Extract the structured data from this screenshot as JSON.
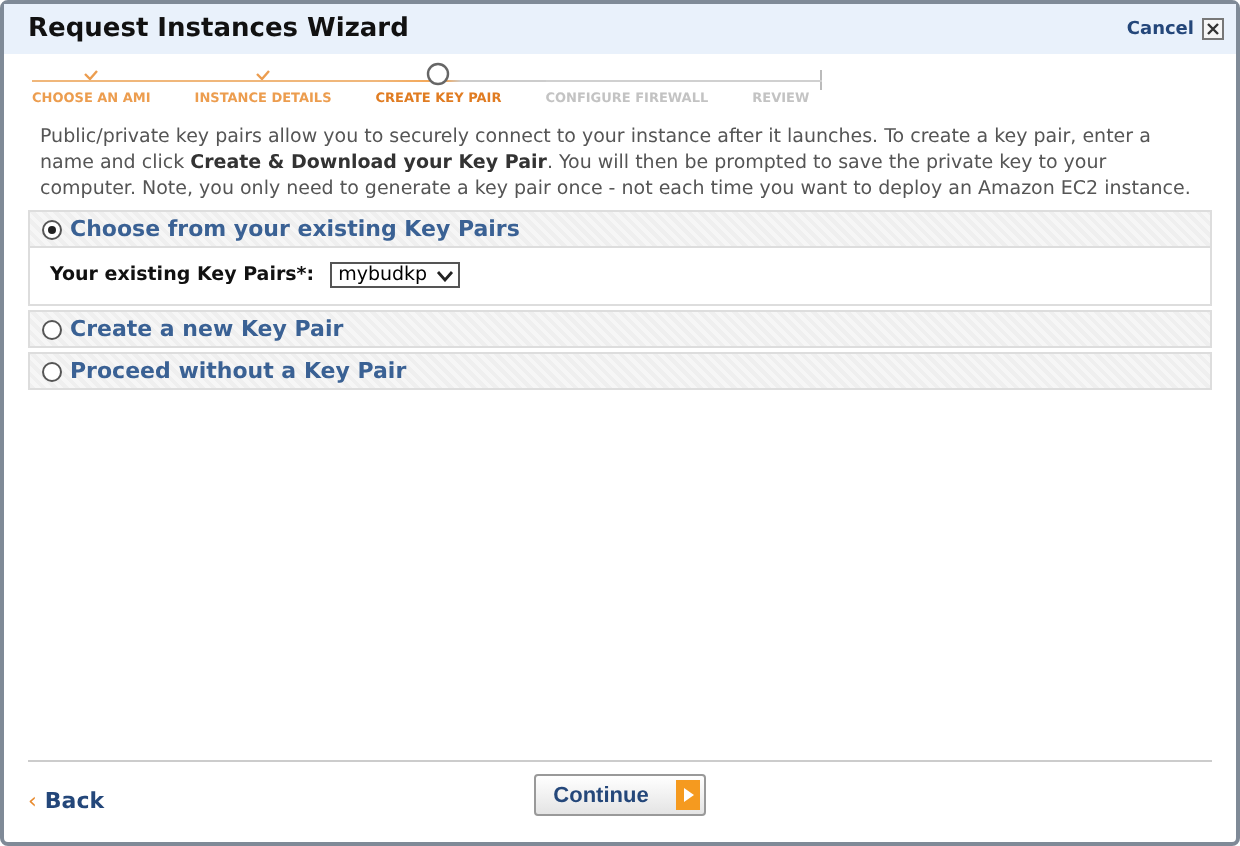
{
  "window": {
    "title": "Request Instances Wizard",
    "cancel": "Cancel"
  },
  "steps": [
    {
      "label": "CHOOSE AN AMI",
      "completed": true,
      "selected": false
    },
    {
      "label": "INSTANCE DETAILS",
      "completed": true,
      "selected": false
    },
    {
      "label": "CREATE KEY PAIR",
      "completed": false,
      "selected": true
    },
    {
      "label": "CONFIGURE FIREWALL",
      "completed": false,
      "selected": false
    },
    {
      "label": "REVIEW",
      "completed": false,
      "selected": false
    }
  ],
  "description": "Public/private key pairs allow you to securely connect to your instance after it launches. To create a key pair, enter a name and click **Create & Download your Key Pair**. You will then be prompted to save the private key to your computer. Note, you only need to generate a key pair once - not each time you want to deploy an Amazon EC2 instance.",
  "options": [
    {
      "label": "Choose from your existing Key Pairs",
      "selected": true,
      "field": {
        "label": "Your existing Key Pairs*:",
        "value": "mybudkp"
      }
    },
    {
      "label": "Create a new Key Pair",
      "selected": false
    },
    {
      "label": "Proceed without a Key Pair",
      "selected": false
    }
  ],
  "footer": {
    "back": {
      "icon": "‹",
      "label": "Back"
    },
    "continue": "Continue"
  }
}
